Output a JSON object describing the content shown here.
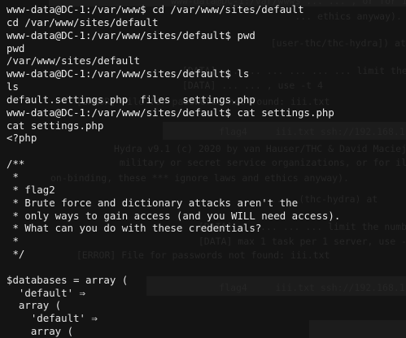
{
  "terminal": {
    "lines": [
      {
        "kind": "prompt",
        "text": "www-data@DC-1:/var/www$ cd /var/www/sites/default"
      },
      {
        "kind": "echo",
        "text": "cd /var/www/sites/default"
      },
      {
        "kind": "prompt",
        "text": "www-data@DC-1:/var/www/sites/default$ pwd"
      },
      {
        "kind": "echo",
        "text": "pwd"
      },
      {
        "kind": "output",
        "text": "/var/www/sites/default"
      },
      {
        "kind": "prompt",
        "text": "www-data@DC-1:/var/www/sites/default$ ls"
      },
      {
        "kind": "echo",
        "text": "ls"
      },
      {
        "kind": "output",
        "text": "default.settings.php  files  settings.php"
      },
      {
        "kind": "prompt",
        "text": "www-data@DC-1:/var/www/sites/default$ cat settings.php"
      },
      {
        "kind": "echo",
        "text": "cat settings.php"
      },
      {
        "kind": "output",
        "text": "<?php"
      },
      {
        "kind": "output",
        "text": ""
      },
      {
        "kind": "output",
        "text": "/**"
      },
      {
        "kind": "output",
        "text": " *"
      },
      {
        "kind": "output",
        "text": " * flag2"
      },
      {
        "kind": "output",
        "text": " * Brute force and dictionary attacks aren't the"
      },
      {
        "kind": "output",
        "text": " * only ways to gain access (and you WILL need access)."
      },
      {
        "kind": "output",
        "text": " * What can you do with these credentials?"
      },
      {
        "kind": "output",
        "text": " *"
      },
      {
        "kind": "output",
        "text": " */"
      },
      {
        "kind": "output",
        "text": ""
      },
      {
        "kind": "output",
        "text": "$databases = array ("
      },
      {
        "kind": "output",
        "text": "  'default' ⇒"
      },
      {
        "kind": "output",
        "text": "  array ("
      },
      {
        "kind": "output",
        "text": "    'default' ⇒"
      },
      {
        "kind": "output",
        "text": "    array ("
      }
    ],
    "background_text": [
      {
        "text": "www-data@DC-1:/var/www$ ... ... , or for il"
      },
      {
        "text": "                      ... ethics anyway)."
      },
      {
        "text": "                 [user-thc/thc-hydra]) at"
      },
      {
        "text": "  [DATA] ... ... ... ... ... ... limit the number of"
      },
      {
        "text": "  [DATA] ... ... , use -t 4"
      },
      {
        "text": "  [ERROR] File for passwords not found: iii.txt"
      },
      {
        "text": "          flag4     iii.txt ssh://192.168.1.248"
      },
      {
        "text": "Hydra v9.1 (c) 2020 by van Hauser/THC & David Maciejak"
      },
      {
        "text": " military or secret service organizations, or for il"
      },
      {
        "text": "on-binding, these *** ignore laws and ethics anyway)."
      },
      {
        "text": "                 ...  (thc-hydra) at"
      },
      {
        "text": "  [DATA] ... ... ... ... limit the number of"
      },
      {
        "text": "  [DATA] max 1 task per 1 server, use -t 4"
      },
      {
        "text": "  [ERROR] File for passwords not found: iii.txt"
      },
      {
        "text": "          flag4     iii.txt ssh://192.168.1.248"
      }
    ],
    "colors": {
      "background": "#141414",
      "foreground": "#e6e6e6",
      "ghost_text": "#262626"
    }
  }
}
